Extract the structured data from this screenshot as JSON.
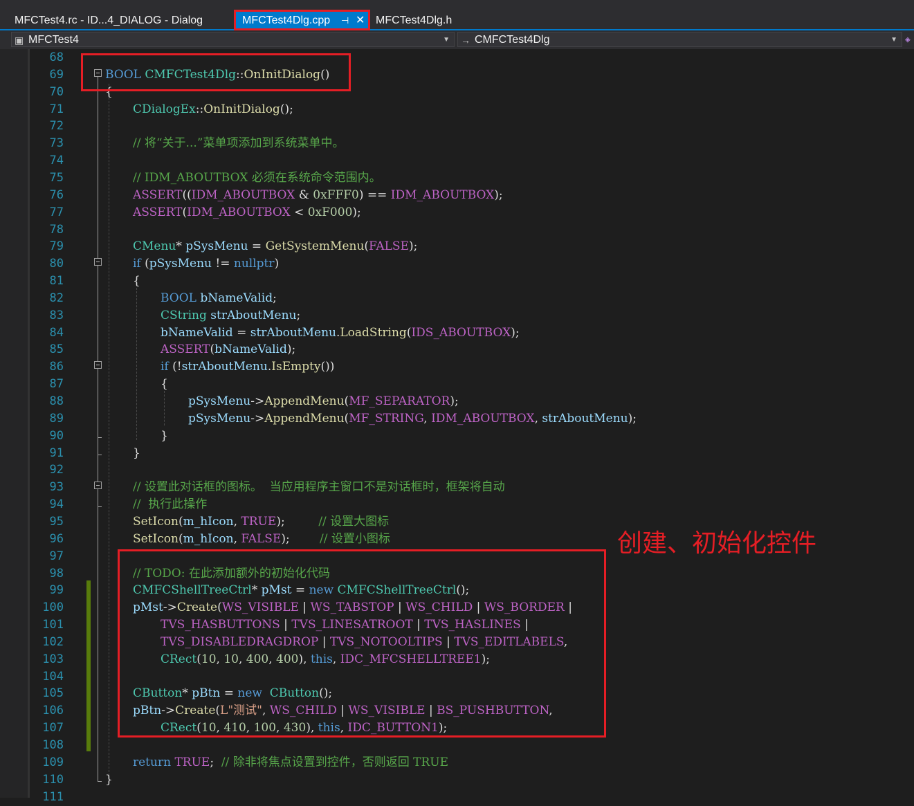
{
  "tabs": [
    {
      "label": "MFCTest4.rc - ID...4_DIALOG - Dialog",
      "active": false
    },
    {
      "label": "MFCTest4Dlg.cpp",
      "active": true,
      "pin_icon": "pin-icon",
      "close_icon": "close-icon"
    },
    {
      "label": "MFCTest4Dlg.h",
      "active": false
    }
  ],
  "nav": {
    "project": "MFCTest4",
    "class": "CMFCTest4Dlg"
  },
  "annotation": "创建、初始化控件",
  "colors": {
    "background": "#1e1e1e",
    "tab_active": "#007acc",
    "annotation_red": "#e51e25",
    "keyword": "#569cd6",
    "type": "#4ec9b0",
    "function": "#dcdcaa",
    "macro": "#bd63c5",
    "comment": "#57a64a",
    "line_number": "#2b91af"
  },
  "lines": [
    {
      "n": "68",
      "indent": 0,
      "tokens": []
    },
    {
      "n": "69",
      "indent": 0,
      "tokens": [
        [
          "kw",
          "BOOL"
        ],
        [
          "plain",
          " "
        ],
        [
          "type",
          "CMFCTest4Dlg"
        ],
        [
          "plain",
          "::"
        ],
        [
          "fn",
          "OnInitDialog"
        ],
        [
          "plain",
          "()"
        ]
      ]
    },
    {
      "n": "70",
      "indent": 0,
      "tokens": [
        [
          "plain",
          "{"
        ]
      ]
    },
    {
      "n": "71",
      "indent": 1,
      "tokens": [
        [
          "type",
          "CDialogEx"
        ],
        [
          "plain",
          "::"
        ],
        [
          "fn",
          "OnInitDialog"
        ],
        [
          "plain",
          "();"
        ]
      ]
    },
    {
      "n": "72",
      "indent": 1,
      "tokens": []
    },
    {
      "n": "73",
      "indent": 1,
      "tokens": [
        [
          "com",
          "// 将“关于...”菜单项添加到系统菜单中。"
        ]
      ]
    },
    {
      "n": "74",
      "indent": 1,
      "tokens": []
    },
    {
      "n": "75",
      "indent": 1,
      "tokens": [
        [
          "com",
          "// IDM_ABOUTBOX 必须在系统命令范围内。"
        ]
      ]
    },
    {
      "n": "76",
      "indent": 1,
      "tokens": [
        [
          "mac",
          "ASSERT"
        ],
        [
          "plain",
          "(("
        ],
        [
          "mac",
          "IDM_ABOUTBOX"
        ],
        [
          "plain",
          " & "
        ],
        [
          "num",
          "0xFFF0"
        ],
        [
          "plain",
          ") == "
        ],
        [
          "mac",
          "IDM_ABOUTBOX"
        ],
        [
          "plain",
          ");"
        ]
      ]
    },
    {
      "n": "77",
      "indent": 1,
      "tokens": [
        [
          "mac",
          "ASSERT"
        ],
        [
          "plain",
          "("
        ],
        [
          "mac",
          "IDM_ABOUTBOX"
        ],
        [
          "plain",
          " < "
        ],
        [
          "num",
          "0xF000"
        ],
        [
          "plain",
          ");"
        ]
      ]
    },
    {
      "n": "78",
      "indent": 1,
      "tokens": []
    },
    {
      "n": "79",
      "indent": 1,
      "tokens": [
        [
          "type",
          "CMenu"
        ],
        [
          "plain",
          "* "
        ],
        [
          "var",
          "pSysMenu"
        ],
        [
          "plain",
          " = "
        ],
        [
          "fn",
          "GetSystemMenu"
        ],
        [
          "plain",
          "("
        ],
        [
          "mac",
          "FALSE"
        ],
        [
          "plain",
          ");"
        ]
      ]
    },
    {
      "n": "80",
      "indent": 1,
      "tokens": [
        [
          "kw",
          "if"
        ],
        [
          "plain",
          " ("
        ],
        [
          "var",
          "pSysMenu"
        ],
        [
          "plain",
          " != "
        ],
        [
          "kw",
          "nullptr"
        ],
        [
          "plain",
          ")"
        ]
      ]
    },
    {
      "n": "81",
      "indent": 1,
      "tokens": [
        [
          "plain",
          "{"
        ]
      ]
    },
    {
      "n": "82",
      "indent": 2,
      "tokens": [
        [
          "kw",
          "BOOL"
        ],
        [
          "plain",
          " "
        ],
        [
          "var",
          "bNameValid"
        ],
        [
          "plain",
          ";"
        ]
      ]
    },
    {
      "n": "83",
      "indent": 2,
      "tokens": [
        [
          "type",
          "CString"
        ],
        [
          "plain",
          " "
        ],
        [
          "var",
          "strAboutMenu"
        ],
        [
          "plain",
          ";"
        ]
      ]
    },
    {
      "n": "84",
      "indent": 2,
      "tokens": [
        [
          "var",
          "bNameValid"
        ],
        [
          "plain",
          " = "
        ],
        [
          "var",
          "strAboutMenu"
        ],
        [
          "plain",
          "."
        ],
        [
          "fn",
          "LoadString"
        ],
        [
          "plain",
          "("
        ],
        [
          "mac",
          "IDS_ABOUTBOX"
        ],
        [
          "plain",
          ");"
        ]
      ]
    },
    {
      "n": "85",
      "indent": 2,
      "tokens": [
        [
          "mac",
          "ASSERT"
        ],
        [
          "plain",
          "("
        ],
        [
          "var",
          "bNameValid"
        ],
        [
          "plain",
          ");"
        ]
      ]
    },
    {
      "n": "86",
      "indent": 2,
      "tokens": [
        [
          "kw",
          "if"
        ],
        [
          "plain",
          " (!"
        ],
        [
          "var",
          "strAboutMenu"
        ],
        [
          "plain",
          "."
        ],
        [
          "fn",
          "IsEmpty"
        ],
        [
          "plain",
          "())"
        ]
      ]
    },
    {
      "n": "87",
      "indent": 2,
      "tokens": [
        [
          "plain",
          "{"
        ]
      ]
    },
    {
      "n": "88",
      "indent": 3,
      "tokens": [
        [
          "var",
          "pSysMenu"
        ],
        [
          "plain",
          "->"
        ],
        [
          "fn",
          "AppendMenu"
        ],
        [
          "plain",
          "("
        ],
        [
          "mac",
          "MF_SEPARATOR"
        ],
        [
          "plain",
          ");"
        ]
      ]
    },
    {
      "n": "89",
      "indent": 3,
      "tokens": [
        [
          "var",
          "pSysMenu"
        ],
        [
          "plain",
          "->"
        ],
        [
          "fn",
          "AppendMenu"
        ],
        [
          "plain",
          "("
        ],
        [
          "mac",
          "MF_STRING"
        ],
        [
          "plain",
          ", "
        ],
        [
          "mac",
          "IDM_ABOUTBOX"
        ],
        [
          "plain",
          ", "
        ],
        [
          "var",
          "strAboutMenu"
        ],
        [
          "plain",
          ");"
        ]
      ]
    },
    {
      "n": "90",
      "indent": 2,
      "tokens": [
        [
          "plain",
          "}"
        ]
      ]
    },
    {
      "n": "91",
      "indent": 1,
      "tokens": [
        [
          "plain",
          "}"
        ]
      ]
    },
    {
      "n": "92",
      "indent": 1,
      "tokens": []
    },
    {
      "n": "93",
      "indent": 1,
      "tokens": [
        [
          "com",
          "// 设置此对话框的图标。  当应用程序主窗口不是对话框时，框架将自动"
        ]
      ]
    },
    {
      "n": "94",
      "indent": 1,
      "tokens": [
        [
          "com",
          "//  执行此操作"
        ]
      ]
    },
    {
      "n": "95",
      "indent": 1,
      "tokens": [
        [
          "fn",
          "SetIcon"
        ],
        [
          "plain",
          "("
        ],
        [
          "var",
          "m_hIcon"
        ],
        [
          "plain",
          ", "
        ],
        [
          "mac",
          "TRUE"
        ],
        [
          "plain",
          ");         "
        ],
        [
          "com",
          "// 设置大图标"
        ]
      ]
    },
    {
      "n": "96",
      "indent": 1,
      "tokens": [
        [
          "fn",
          "SetIcon"
        ],
        [
          "plain",
          "("
        ],
        [
          "var",
          "m_hIcon"
        ],
        [
          "plain",
          ", "
        ],
        [
          "mac",
          "FALSE"
        ],
        [
          "plain",
          ");        "
        ],
        [
          "com",
          "// 设置小图标"
        ]
      ]
    },
    {
      "n": "97",
      "indent": 1,
      "tokens": []
    },
    {
      "n": "98",
      "indent": 1,
      "tokens": [
        [
          "com",
          "// TODO: 在此添加额外的初始化代码"
        ]
      ]
    },
    {
      "n": "99",
      "indent": 1,
      "tokens": [
        [
          "type",
          "CMFCShellTreeCtrl"
        ],
        [
          "plain",
          "* "
        ],
        [
          "var",
          "pMst"
        ],
        [
          "plain",
          " = "
        ],
        [
          "kw",
          "new"
        ],
        [
          "plain",
          " "
        ],
        [
          "type",
          "CMFCShellTreeCtrl"
        ],
        [
          "plain",
          "();"
        ]
      ]
    },
    {
      "n": "100",
      "indent": 1,
      "tokens": [
        [
          "var",
          "pMst"
        ],
        [
          "plain",
          "->"
        ],
        [
          "fn",
          "Create"
        ],
        [
          "plain",
          "("
        ],
        [
          "mac",
          "WS_VISIBLE"
        ],
        [
          "plain",
          " | "
        ],
        [
          "mac",
          "WS_TABSTOP"
        ],
        [
          "plain",
          " | "
        ],
        [
          "mac",
          "WS_CHILD"
        ],
        [
          "plain",
          " | "
        ],
        [
          "mac",
          "WS_BORDER"
        ],
        [
          "plain",
          " |"
        ]
      ]
    },
    {
      "n": "101",
      "indent": 2,
      "tokens": [
        [
          "mac",
          "TVS_HASBUTTONS"
        ],
        [
          "plain",
          " | "
        ],
        [
          "mac",
          "TVS_LINESATROOT"
        ],
        [
          "plain",
          " | "
        ],
        [
          "mac",
          "TVS_HASLINES"
        ],
        [
          "plain",
          " |"
        ]
      ]
    },
    {
      "n": "102",
      "indent": 2,
      "tokens": [
        [
          "mac",
          "TVS_DISABLEDRAGDROP"
        ],
        [
          "plain",
          " | "
        ],
        [
          "mac",
          "TVS_NOTOOLTIPS"
        ],
        [
          "plain",
          " | "
        ],
        [
          "mac",
          "TVS_EDITLABELS"
        ],
        [
          "plain",
          ","
        ]
      ]
    },
    {
      "n": "103",
      "indent": 2,
      "tokens": [
        [
          "type",
          "CRect"
        ],
        [
          "plain",
          "("
        ],
        [
          "num",
          "10"
        ],
        [
          "plain",
          ", "
        ],
        [
          "num",
          "10"
        ],
        [
          "plain",
          ", "
        ],
        [
          "num",
          "400"
        ],
        [
          "plain",
          ", "
        ],
        [
          "num",
          "400"
        ],
        [
          "plain",
          "), "
        ],
        [
          "kw",
          "this"
        ],
        [
          "plain",
          ", "
        ],
        [
          "mac",
          "IDC_MFCSHELLTREE1"
        ],
        [
          "plain",
          ");"
        ]
      ]
    },
    {
      "n": "104",
      "indent": 1,
      "tokens": []
    },
    {
      "n": "105",
      "indent": 1,
      "tokens": [
        [
          "type",
          "CButton"
        ],
        [
          "plain",
          "* "
        ],
        [
          "var",
          "pBtn"
        ],
        [
          "plain",
          " = "
        ],
        [
          "kw",
          "new"
        ],
        [
          "plain",
          "  "
        ],
        [
          "type",
          "CButton"
        ],
        [
          "plain",
          "();"
        ]
      ]
    },
    {
      "n": "106",
      "indent": 1,
      "tokens": [
        [
          "var",
          "pBtn"
        ],
        [
          "plain",
          "->"
        ],
        [
          "fn",
          "Create"
        ],
        [
          "plain",
          "("
        ],
        [
          "str",
          "L\"测试\""
        ],
        [
          "plain",
          ", "
        ],
        [
          "mac",
          "WS_CHILD"
        ],
        [
          "plain",
          " | "
        ],
        [
          "mac",
          "WS_VISIBLE"
        ],
        [
          "plain",
          " | "
        ],
        [
          "mac",
          "BS_PUSHBUTTON"
        ],
        [
          "plain",
          ","
        ]
      ]
    },
    {
      "n": "107",
      "indent": 2,
      "tokens": [
        [
          "type",
          "CRect"
        ],
        [
          "plain",
          "("
        ],
        [
          "num",
          "10"
        ],
        [
          "plain",
          ", "
        ],
        [
          "num",
          "410"
        ],
        [
          "plain",
          ", "
        ],
        [
          "num",
          "100"
        ],
        [
          "plain",
          ", "
        ],
        [
          "num",
          "430"
        ],
        [
          "plain",
          "), "
        ],
        [
          "kw",
          "this"
        ],
        [
          "plain",
          ", "
        ],
        [
          "mac",
          "IDC_BUTTON1"
        ],
        [
          "plain",
          ");"
        ]
      ]
    },
    {
      "n": "108",
      "indent": 1,
      "tokens": []
    },
    {
      "n": "109",
      "indent": 1,
      "tokens": [
        [
          "kw",
          "return"
        ],
        [
          "plain",
          " "
        ],
        [
          "mac",
          "TRUE"
        ],
        [
          "plain",
          ";  "
        ],
        [
          "com",
          "// 除非将焦点设置到控件，否则返回 TRUE"
        ]
      ]
    },
    {
      "n": "110",
      "indent": 0,
      "tokens": [
        [
          "plain",
          "}"
        ]
      ]
    },
    {
      "n": "111",
      "indent": 0,
      "tokens": []
    }
  ]
}
